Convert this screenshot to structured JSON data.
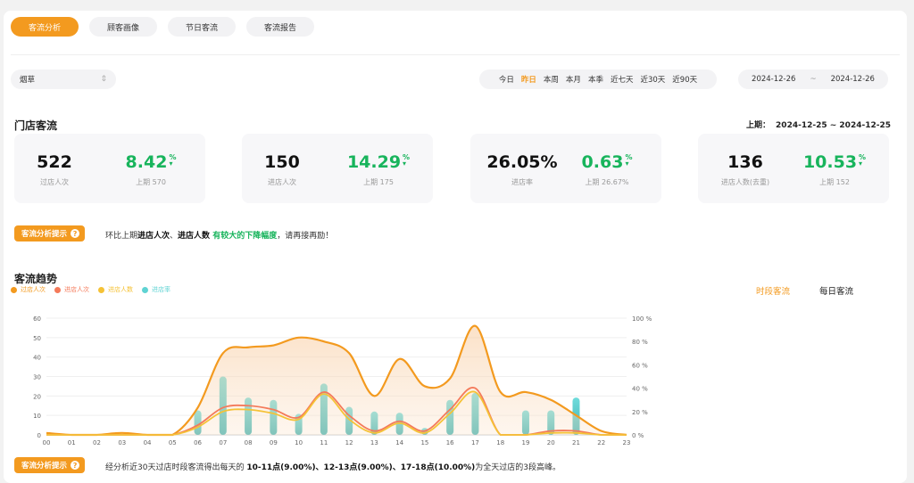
{
  "tabs": [
    {
      "label": "客流分析",
      "active": true
    },
    {
      "label": "顾客画像",
      "active": false
    },
    {
      "label": "节日客流",
      "active": false
    },
    {
      "label": "客流报告",
      "active": false
    }
  ],
  "store_select": {
    "value": "烟草"
  },
  "periods": [
    "今日",
    "昨日",
    "本周",
    "本月",
    "本季",
    "近七天",
    "近30天",
    "近90天"
  ],
  "active_period": "昨日",
  "date_range": {
    "start": "2024-12-26",
    "sep": "~",
    "end": "2024-12-26"
  },
  "section_store": "门店客流",
  "prev_range": {
    "label": "上期：",
    "value": "2024-12-25 ~ 2024-12-25"
  },
  "metrics": [
    {
      "value": "522",
      "label": "过店人次",
      "pct": "8.42",
      "pct_unit": "%",
      "prev": "上期 570"
    },
    {
      "value": "150",
      "label": "进店人次",
      "pct": "14.29",
      "pct_unit": "%",
      "prev": "上期 175"
    },
    {
      "value": "26.05%",
      "label": "进店率",
      "pct": "0.63",
      "pct_unit": "%",
      "prev": "上期 26.67%"
    },
    {
      "value": "136",
      "label": "进店人数(去重)",
      "pct": "10.53",
      "pct_unit": "%",
      "prev": "上期 152"
    }
  ],
  "hint_badge": "客流分析提示",
  "hint1": {
    "p1": "环比上期",
    "b1": "进店人次",
    "p2": "、",
    "b2": "进店人数",
    "g": " 有较大的下降幅度",
    "p3": "，请再接再励！"
  },
  "section_trend": "客流趋势",
  "chart_toggle": {
    "hourly": "时段客流",
    "daily": "每日客流"
  },
  "hint2": {
    "p1": "经分析近30天过店时段客流得出每天的 ",
    "b": "10-11点(9.00%)、12-13点(9.00%)、17-18点(10.00%)",
    "p2": "为全天过店的3段高峰。"
  },
  "colors": {
    "accent": "#f39a1f",
    "green": "#18b45c",
    "pass": "#f39a1f",
    "enter": "#f47a5a",
    "visitors": "#f5c236",
    "rate": "#5fd3d3"
  },
  "chart_data": {
    "type": "line",
    "x": [
      "00",
      "01",
      "02",
      "03",
      "04",
      "05",
      "06",
      "07",
      "08",
      "09",
      "10",
      "11",
      "12",
      "13",
      "14",
      "15",
      "16",
      "17",
      "18",
      "19",
      "20",
      "21",
      "22",
      "23"
    ],
    "ylim": [
      0,
      60
    ],
    "yticks": [
      0,
      10,
      20,
      30,
      40,
      50,
      60
    ],
    "y2lim": [
      0,
      100
    ],
    "y2ticks": [
      "0 %",
      "20 %",
      "40 %",
      "60 %",
      "80 %",
      "100 %"
    ],
    "series": [
      {
        "name": "过店人次",
        "type": "area",
        "axis": "left",
        "values": [
          1,
          0,
          0,
          1,
          0,
          0,
          14,
          42,
          45,
          46,
          50,
          48,
          42,
          20,
          39,
          25,
          29,
          56,
          22,
          22,
          18,
          10,
          2,
          0
        ]
      },
      {
        "name": "进店人次",
        "type": "line",
        "axis": "left",
        "values": [
          0,
          0,
          0,
          0,
          0,
          0,
          5,
          14,
          15,
          13,
          9,
          22,
          10,
          2,
          7,
          2,
          13,
          24,
          0,
          0,
          2,
          2,
          0,
          0
        ]
      },
      {
        "name": "进店人数",
        "type": "line",
        "axis": "left",
        "values": [
          0,
          0,
          0,
          0,
          0,
          0,
          4,
          12,
          13,
          11,
          8,
          21,
          8,
          1,
          6,
          1,
          11,
          22,
          0,
          0,
          1,
          1,
          0,
          0
        ]
      },
      {
        "name": "进店率",
        "type": "bar",
        "axis": "right",
        "values": [
          0,
          0,
          0,
          0,
          0,
          0,
          21,
          50,
          32,
          30,
          18,
          44,
          24,
          20,
          19,
          6,
          30,
          36,
          0,
          21,
          21,
          32,
          0,
          0
        ]
      }
    ]
  }
}
